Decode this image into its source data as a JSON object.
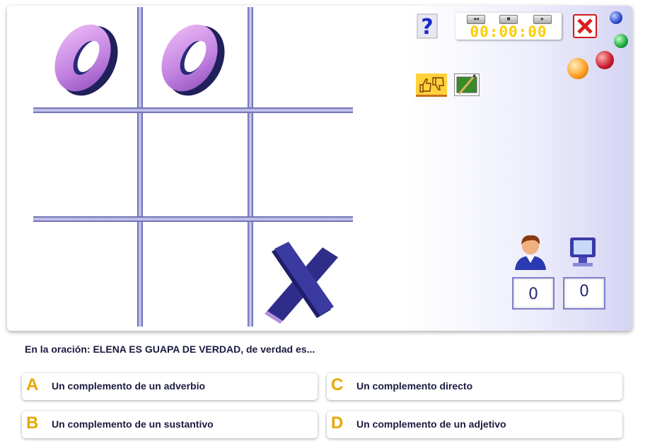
{
  "board": {
    "cells": [
      "O",
      "O",
      "",
      "",
      "",
      "",
      "",
      "",
      "X"
    ]
  },
  "panel": {
    "help_glyph": "?",
    "timer": {
      "display": "00:00:00",
      "rewind_glyph": "◂◂",
      "stop_glyph": "■",
      "play_glyph": "▸"
    },
    "close_glyph": "✕",
    "colors": {
      "ball_blue": "#2a4ad0",
      "ball_green": "#1aa83a",
      "ball_red": "#c81a2a",
      "ball_orange": "#ff9a1a"
    },
    "scores": {
      "player": "0",
      "computer": "0"
    }
  },
  "question": {
    "text": "En la oración: ELENA ES GUAPA DE VERDAD, de verdad es..."
  },
  "answers": [
    {
      "letter": "A",
      "text": "Un complemento de un adverbio"
    },
    {
      "letter": "B",
      "text": "Un complemento de un sustantivo"
    },
    {
      "letter": "C",
      "text": "Un complemento directo"
    },
    {
      "letter": "D",
      "text": "Un complemento de un adjetivo"
    }
  ]
}
